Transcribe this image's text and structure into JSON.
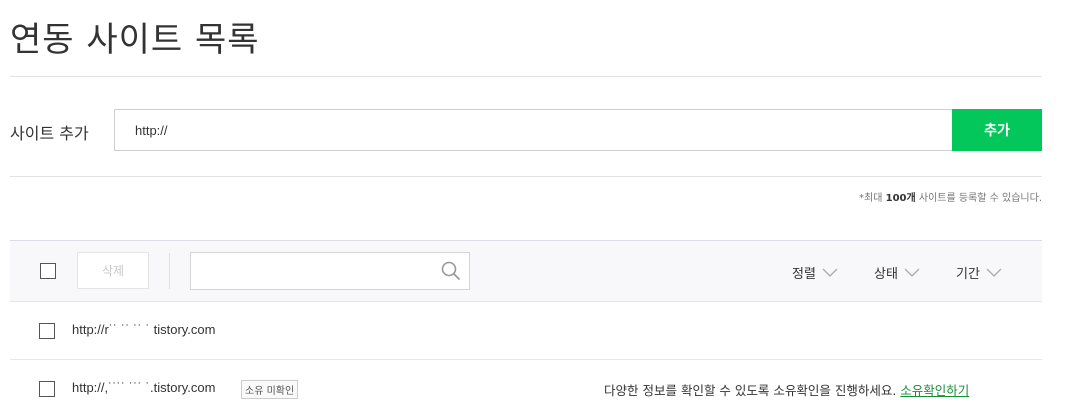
{
  "page": {
    "title": "연동 사이트 목록"
  },
  "add_site": {
    "label": "사이트 추가",
    "input_value": "http://",
    "button_label": "추가",
    "accent_color": "#03c75a"
  },
  "note": {
    "prefix": "*최대 ",
    "count": "100개",
    "suffix": " 사이트를 등록할 수 있습니다."
  },
  "toolbar": {
    "delete_label": "삭제",
    "search_placeholder": "",
    "sort_label": "정렬",
    "status_label": "상태",
    "period_label": "기간"
  },
  "sites": [
    {
      "url": "http://r˙˙ ˙˙ ˙˙ ˙ tistory.com"
    },
    {
      "url": "http://,˙˙˙˙ ˙˙˙ ˙.tistory.com",
      "badge": "소유 미확인",
      "message": "다양한 정보를 확인할 수 있도록 소유확인을 진행하세요. ",
      "link": "소유확인하기"
    }
  ]
}
